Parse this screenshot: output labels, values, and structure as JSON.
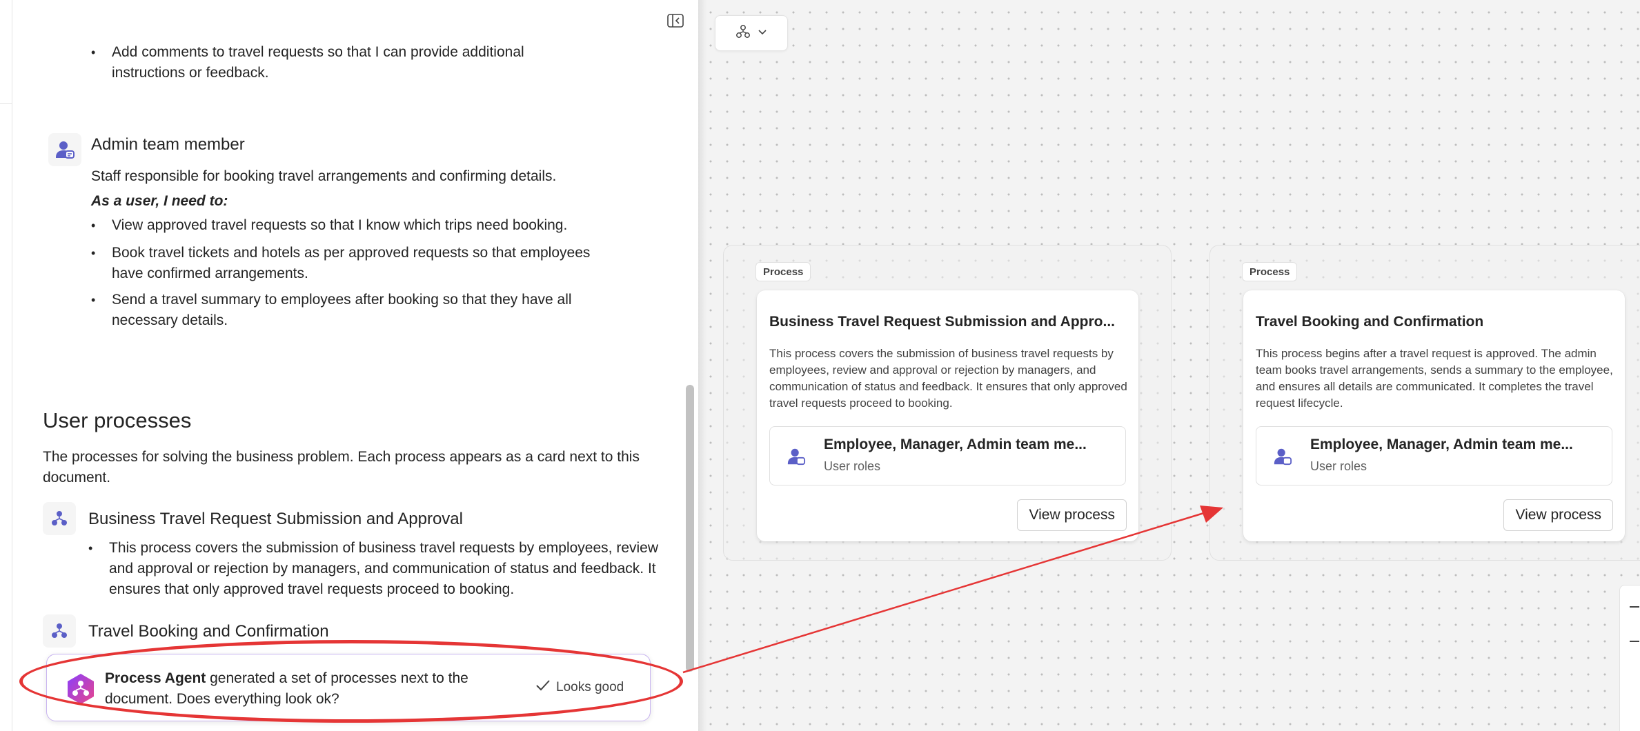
{
  "document": {
    "top_bullet": "Add comments to travel requests so that I can provide additional instructions or feedback.",
    "role": {
      "title": "Admin team member",
      "description": "Staff responsible for booking travel arrangements and confirming details.",
      "need_label": "As a user, I need to:",
      "needs": [
        "View approved travel requests so that I know which trips need booking.",
        "Book travel tickets and hotels as per approved requests so that employees have confirmed arrangements.",
        "Send a travel summary to employees after booking so that they have all necessary details."
      ]
    },
    "processes_section": {
      "title": "User processes",
      "description": "The processes for solving the business problem. Each process appears as a card next to this document.",
      "items": [
        {
          "title": "Business Travel Request Submission and Approval",
          "bullet": "This process covers the submission of business travel requests by employees, review and approval or rejection by managers, and communication of status and feedback. It ensures that only approved travel requests proceed to booking."
        },
        {
          "title": "Travel Booking and Confirmation"
        }
      ]
    },
    "notification": {
      "agent": "Process Agent",
      "message": " generated a set of processes next to the document. Does everything look ok?",
      "action": "Looks good"
    }
  },
  "canvas": {
    "groups": [
      {
        "tag": "Process",
        "card": {
          "title": "Business Travel Request Submission and Appro...",
          "description": "This process covers the submission of business travel requests by employees, review and approval or rejection by managers, and communication of status and feedback. It ensures that only approved travel requests proceed to booking.",
          "roles": "Employee, Manager, Admin team me...",
          "roles_label": "User roles",
          "button": "View process"
        }
      },
      {
        "tag": "Process",
        "card": {
          "title": "Travel Booking and Confirmation",
          "description": "This process begins after a travel request is approved. The admin team books travel arrangements, sends a summary to the employee, and ensures all details are communicated. It completes the travel request lifecycle.",
          "roles": "Employee, Manager, Admin team me...",
          "roles_label": "User roles",
          "button": "View process"
        }
      }
    ]
  },
  "colors": {
    "accent": "#5b5fc7",
    "annotation": "#e53535",
    "agent_gradient_start": "#8a3ffc",
    "agent_gradient_end": "#e8458b"
  }
}
